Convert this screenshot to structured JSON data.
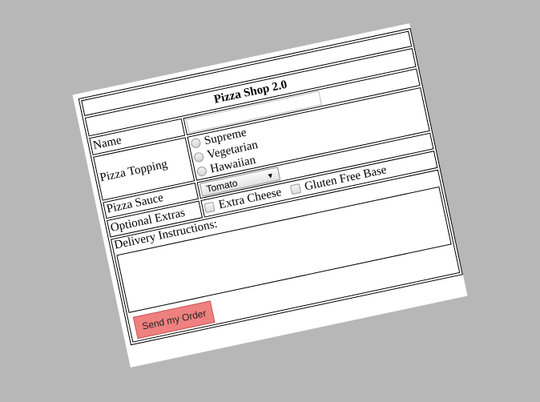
{
  "form": {
    "title": "Pizza Shop 2.0",
    "name_label": "Name",
    "name_value": "",
    "topping_label": "Pizza Topping",
    "toppings": [
      "Supreme",
      "Vegetarian",
      "Hawaiian"
    ],
    "sauce_label": "Pizza Sauce",
    "sauce_selected": "Tomato",
    "extras_label": "Optional Extras",
    "extras": [
      "Extra Cheese",
      "Gluten Free Base"
    ],
    "delivery_label": "Delivery Instructions:",
    "delivery_value": "",
    "submit_label": "Send my Order"
  },
  "colors": {
    "background": "#b7b7b7",
    "card": "#ffffff",
    "submit_button": "#ee8080"
  },
  "icons": {
    "radio": "radio-button-icon",
    "checkbox": "checkbox-icon",
    "select_arrow": "dropdown-arrow-icon"
  }
}
